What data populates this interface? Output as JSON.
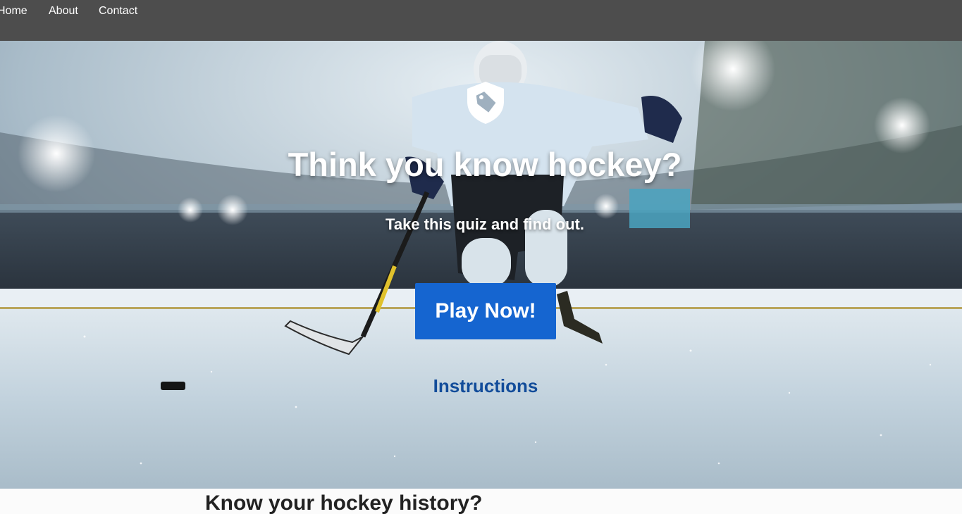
{
  "nav": {
    "items": [
      {
        "label": "Home"
      },
      {
        "label": "About"
      },
      {
        "label": "Contact"
      }
    ]
  },
  "hero": {
    "title": "Think you know hockey?",
    "subtitle": "Take this quiz and find out.",
    "play_label": "Play Now!",
    "instructions_label": "Instructions",
    "badge_icon": "shield-tag-icon",
    "background_image": "hockey-player-ice-arena-photo"
  },
  "section": {
    "heading": "Know your hockey history?"
  },
  "colors": {
    "nav_bg": "#4d4d4d",
    "button_bg": "#1565d0",
    "link": "#124c9a",
    "heading": "#222222"
  }
}
